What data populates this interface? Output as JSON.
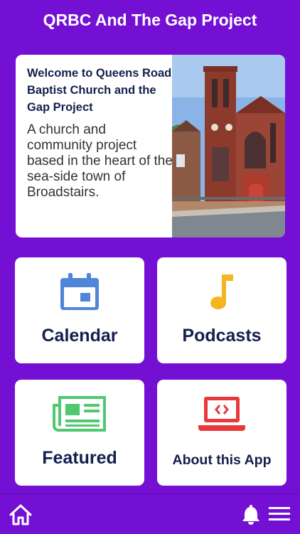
{
  "header": {
    "title": "QRBC And The Gap Project"
  },
  "welcome": {
    "title": "Welcome to Queens Road Baptist Church and the Gap Project",
    "description": " A church and community project based in the heart of the sea-side town of Broadstairs."
  },
  "tiles": [
    {
      "label": "Calendar",
      "icon": "calendar-icon",
      "color": "#4f86d9"
    },
    {
      "label": "Podcasts",
      "icon": "music-note-icon",
      "color": "#f5b520"
    },
    {
      "label": "Featured",
      "icon": "newspaper-icon",
      "color": "#4fc870"
    },
    {
      "label": "About this App",
      "icon": "laptop-code-icon",
      "color": "#e8393c"
    }
  ],
  "bottom_bar": {
    "icons": [
      "home-icon",
      "bell-icon",
      "menu-icon"
    ]
  },
  "colors": {
    "background": "#7410d4",
    "card": "#ffffff",
    "text_dark": "#13204d"
  }
}
